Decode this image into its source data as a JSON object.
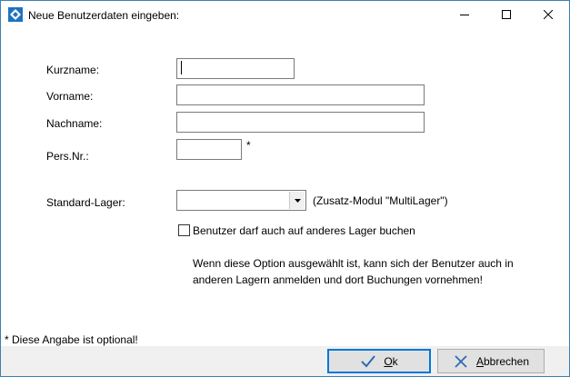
{
  "window": {
    "title": "Neue Benutzerdaten eingeben:",
    "icon": "app-diamond-icon"
  },
  "form": {
    "kurzname": {
      "label": "Kurzname:",
      "value": ""
    },
    "vorname": {
      "label": "Vorname:",
      "value": ""
    },
    "nachname": {
      "label": "Nachname:",
      "value": ""
    },
    "persnr": {
      "label": "Pers.Nr.:",
      "value": "",
      "marker": "*"
    },
    "lager": {
      "label": "Standard-Lager:",
      "selected": "",
      "hint": "(Zusatz-Modul \"MultiLager\")"
    },
    "checkbox": {
      "label": "Benutzer darf auch auf anderes Lager buchen",
      "checked": false
    },
    "description_line1": "Wenn diese Option ausgewählt ist, kann sich der Benutzer auch in",
    "description_line2": "anderen Lagern anmelden und dort Buchungen vornehmen!"
  },
  "footnote": "* Diese Angabe ist optional!",
  "buttons": {
    "ok": {
      "first": "O",
      "rest": "k",
      "icon": "checkmark-icon"
    },
    "cancel": {
      "first": "A",
      "rest": "bbrechen",
      "icon": "x-cross-icon"
    }
  },
  "colors": {
    "accent": "#0078d7",
    "checkmark": "#2d6ab4",
    "footer_bg": "#f0f0f0"
  }
}
